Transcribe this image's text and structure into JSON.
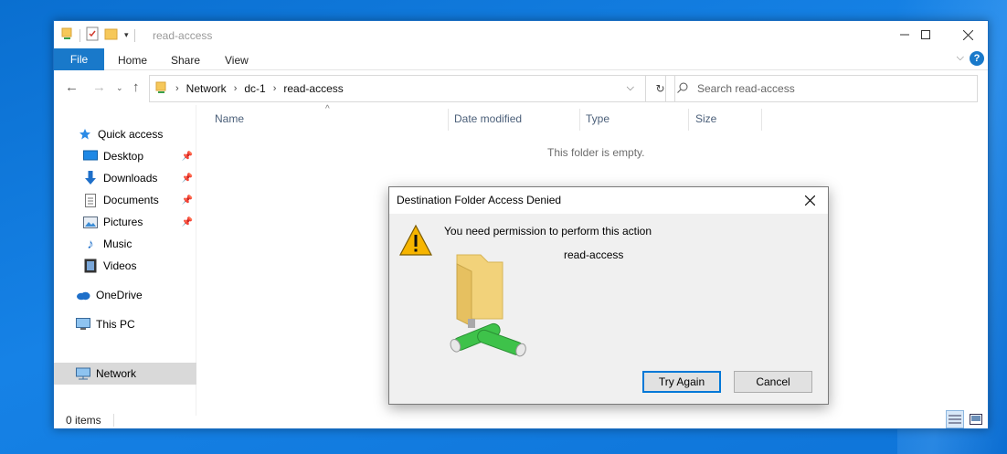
{
  "window": {
    "title": "read-access",
    "minimize_icon": "minimize-icon",
    "maximize_icon": "maximize-icon",
    "close_icon": "close-icon"
  },
  "ribbon": {
    "file_tab": "File",
    "tabs": [
      "Home",
      "Share",
      "View"
    ]
  },
  "address_bar": {
    "breadcrumbs": [
      "Network",
      "dc-1",
      "read-access"
    ],
    "search_placeholder": "Search read-access"
  },
  "sidebar": {
    "items": [
      {
        "label": "Quick access",
        "icon": "star-icon"
      },
      {
        "label": "Desktop",
        "icon": "desktop-icon",
        "pinned": true
      },
      {
        "label": "Downloads",
        "icon": "download-icon",
        "pinned": true
      },
      {
        "label": "Documents",
        "icon": "documents-icon",
        "pinned": true
      },
      {
        "label": "Pictures",
        "icon": "pictures-icon",
        "pinned": true
      },
      {
        "label": "Music",
        "icon": "music-icon"
      },
      {
        "label": "Videos",
        "icon": "videos-icon"
      },
      {
        "label": "OneDrive",
        "icon": "cloud-icon"
      },
      {
        "label": "This PC",
        "icon": "computer-icon"
      },
      {
        "label": "Network",
        "icon": "network-icon",
        "selected": true
      }
    ]
  },
  "content": {
    "columns": [
      "Name",
      "Date modified",
      "Type",
      "Size"
    ],
    "empty_message": "This folder is empty."
  },
  "status_bar": {
    "item_count": "0 items"
  },
  "dialog": {
    "title": "Destination Folder Access Denied",
    "message": "You need permission to perform this action",
    "folder_name": "read-access",
    "try_again_label": "Try Again",
    "cancel_label": "Cancel"
  },
  "colors": {
    "accent": "#1979ca",
    "desktop": "#1682e6",
    "warning": "#f7b500"
  }
}
